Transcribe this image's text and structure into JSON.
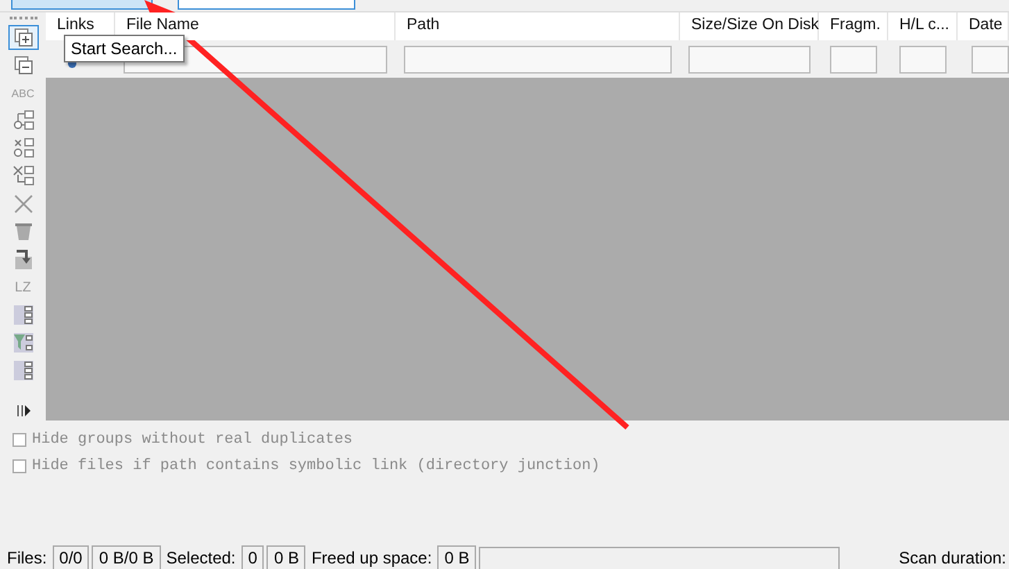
{
  "tools": [
    {
      "kind": "group-plus",
      "selected": true
    },
    {
      "kind": "group-minus",
      "selected": false
    },
    {
      "kind": "text",
      "label": "ABC",
      "selected": false
    },
    {
      "kind": "tree-check",
      "selected": false
    },
    {
      "kind": "tree-star",
      "selected": false
    },
    {
      "kind": "tree-x",
      "selected": false
    },
    {
      "kind": "cross",
      "selected": false
    },
    {
      "kind": "bin",
      "selected": false
    },
    {
      "kind": "move",
      "selected": false
    },
    {
      "kind": "text",
      "label": "LZ",
      "selected": false
    },
    {
      "kind": "list-check",
      "selected": false
    },
    {
      "kind": "filter",
      "selected": false
    },
    {
      "kind": "list",
      "selected": false
    }
  ],
  "tooltip": "Start Search...",
  "table": {
    "columns": [
      "Links",
      "File Name",
      "Path",
      "Size/Size On Disk",
      "Fragm.",
      "H/L c...",
      "Date"
    ]
  },
  "options": [
    {
      "label": "Hide groups without real duplicates",
      "checked": false,
      "disabled": true
    },
    {
      "label": "Hide files if path contains symbolic link (directory junction)",
      "checked": false,
      "disabled": true
    }
  ],
  "status_bar": [
    {
      "kind": "label",
      "text": "Files:"
    },
    {
      "kind": "value",
      "text": "0/0"
    },
    {
      "kind": "value",
      "text": "0 B/0 B"
    },
    {
      "kind": "label",
      "text": "Selected:"
    },
    {
      "kind": "value",
      "text": "0"
    },
    {
      "kind": "value",
      "text": "0 B"
    },
    {
      "kind": "label",
      "text": "Freed up space:"
    },
    {
      "kind": "value",
      "text": "0 B"
    },
    {
      "kind": "box"
    },
    {
      "kind": "label",
      "text": "Scan duration:"
    }
  ]
}
